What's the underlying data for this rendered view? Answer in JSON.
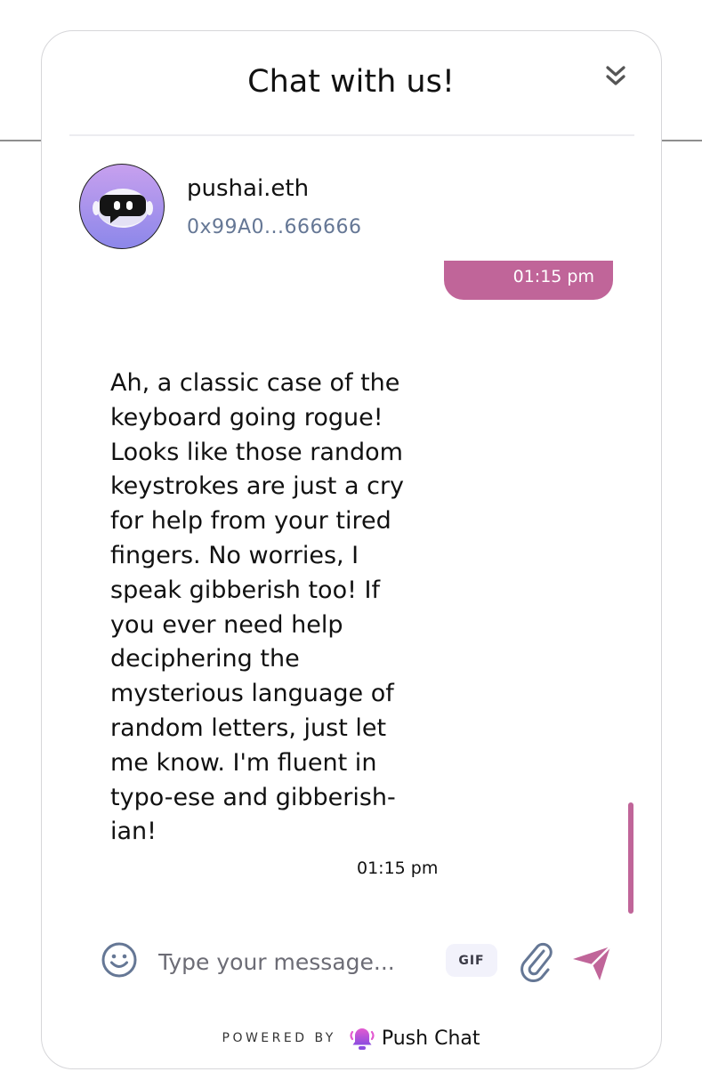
{
  "header": {
    "title": "Chat with us!",
    "minimize_icon": "double-chevron-down-icon"
  },
  "contact": {
    "name": "pushai.eth",
    "address": "0x99A0...666666",
    "avatar_icon": "robot-icon"
  },
  "messages": [
    {
      "direction": "outgoing",
      "text": "",
      "time": "01:15 pm"
    },
    {
      "direction": "incoming",
      "text": "Ah, a classic case of the\nkeyboard going rogue!\nLooks like those random\nkeystrokes are just a cry\nfor help from your tired\nfingers. No worries, I\nspeak gibberish too! If\nyou ever need help\ndeciphering the\nmysterious language of\nrandom letters, just let\nme know. I'm fluent in\ntypo-ese and gibberish-\nian!",
      "time": "01:15 pm"
    }
  ],
  "composer": {
    "placeholder": "Type your message...",
    "value": "",
    "gif_label": "GIF",
    "emoji_icon": "smiley-icon",
    "attach_icon": "paperclip-icon",
    "send_icon": "send-icon"
  },
  "footer": {
    "powered_by": "POWERED BY",
    "brand": "Push Chat",
    "brand_icon": "bell-icon"
  },
  "colors": {
    "accent": "#c06599",
    "address": "#657795",
    "gif_bg": "#f2f2fb",
    "avatar_gradient_top": "#c7a0ee",
    "avatar_gradient_bottom": "#8c87ea"
  }
}
